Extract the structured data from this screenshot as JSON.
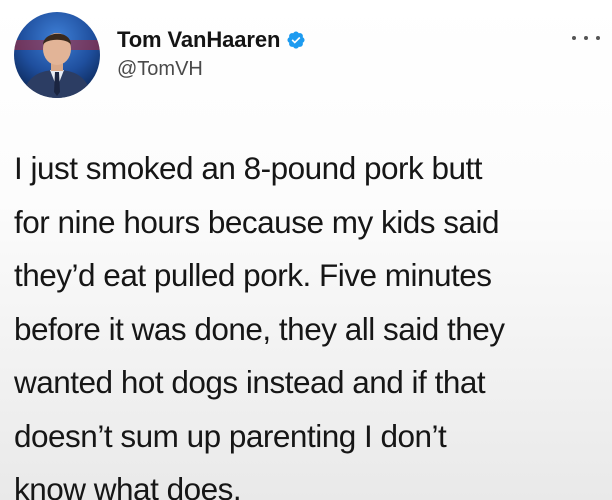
{
  "tweet": {
    "author": {
      "name": "Tom VanHaaren",
      "handle": "@TomVH",
      "verified": true,
      "avatar_icon": "profile-photo"
    },
    "more_icon": "ellipsis-icon",
    "body_lines": [
      "I just smoked an 8-pound pork butt",
      "for nine hours because my kids said",
      "they’d eat pulled pork. Five minutes",
      "before it was done, they all said they",
      "wanted hot dogs instead and if that",
      "doesn’t sum up parenting I don’t",
      "know what does."
    ]
  },
  "colors": {
    "verified_badge": "#1d9bf0",
    "text_primary": "#141414",
    "text_secondary": "#4a4a4a"
  }
}
